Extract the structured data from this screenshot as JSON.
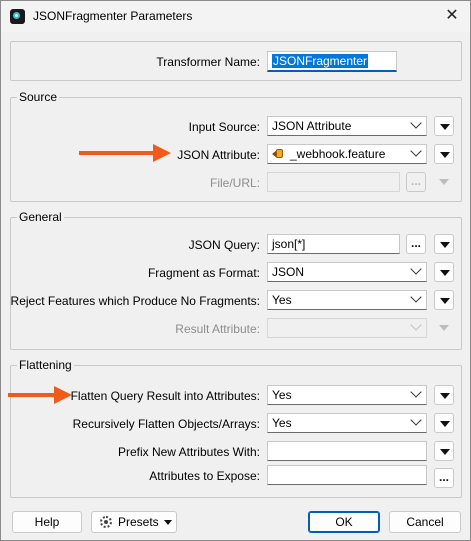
{
  "window": {
    "title": "JSONFragmenter Parameters",
    "close": "✕"
  },
  "transformer": {
    "label": "Transformer Name:",
    "value": "JSONFragmenter"
  },
  "source": {
    "legend": "Source",
    "input_source": {
      "label": "Input Source:",
      "value": "JSON Attribute"
    },
    "json_attribute": {
      "label": "JSON Attribute:",
      "value": "_webhook.feature"
    },
    "file_url": {
      "label": "File/URL:",
      "value": "",
      "browse": "..."
    }
  },
  "general": {
    "legend": "General",
    "json_query": {
      "label": "JSON Query:",
      "value": "json[*]",
      "browse": "..."
    },
    "fragment_format": {
      "label": "Fragment as Format:",
      "value": "JSON"
    },
    "reject_features": {
      "label": "Reject Features which Produce No Fragments:",
      "value": "Yes"
    },
    "result_attribute": {
      "label": "Result Attribute:",
      "value": ""
    }
  },
  "flattening": {
    "legend": "Flattening",
    "flatten_query": {
      "label": "Flatten Query Result into Attributes:",
      "value": "Yes"
    },
    "recursive": {
      "label": "Recursively Flatten Objects/Arrays:",
      "value": "Yes"
    },
    "prefix": {
      "label": "Prefix New Attributes With:",
      "value": ""
    },
    "expose": {
      "label": "Attributes to Expose:",
      "value": "",
      "browse": "..."
    }
  },
  "footer": {
    "help": "Help",
    "presets": "Presets",
    "ok": "OK",
    "cancel": "Cancel"
  },
  "colors": {
    "annotation_arrow": "#f05a1a",
    "selection": "#0078d7",
    "focus": "#005fb8"
  }
}
